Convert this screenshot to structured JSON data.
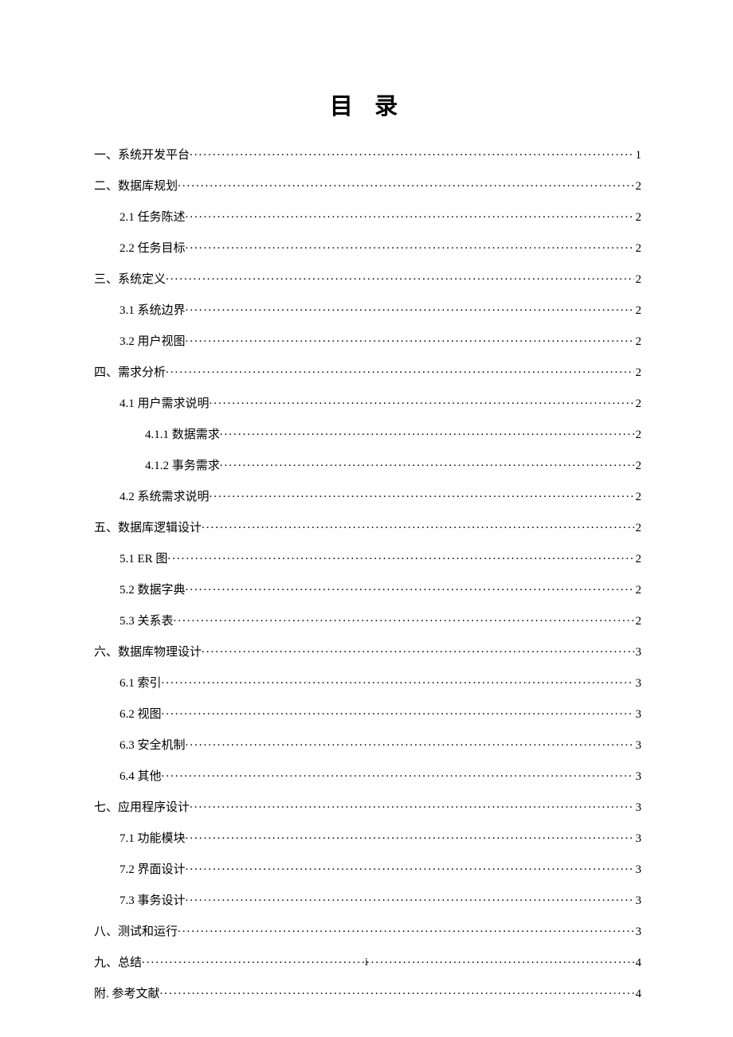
{
  "title": "目 录",
  "page_number": "i",
  "toc": [
    {
      "level": 0,
      "label": "一、系统开发平台",
      "page": "1"
    },
    {
      "level": 0,
      "label": "二、数据库规划",
      "page": "2"
    },
    {
      "level": 1,
      "label": "2.1 任务陈述",
      "page": "2"
    },
    {
      "level": 1,
      "label": "2.2 任务目标",
      "page": "2"
    },
    {
      "level": 0,
      "label": "三、系统定义",
      "page": "2"
    },
    {
      "level": 1,
      "label": "3.1 系统边界",
      "page": "2"
    },
    {
      "level": 1,
      "label": "3.2 用户视图",
      "page": "2"
    },
    {
      "level": 0,
      "label": "四、需求分析",
      "page": "2"
    },
    {
      "level": 1,
      "label": "4.1 用户需求说明",
      "page": "2"
    },
    {
      "level": 2,
      "label": "4.1.1 数据需求",
      "page": "2"
    },
    {
      "level": 2,
      "label": "4.1.2 事务需求",
      "page": "2"
    },
    {
      "level": 1,
      "label": "4.2 系统需求说明",
      "page": "2"
    },
    {
      "level": 0,
      "label": "五、数据库逻辑设计",
      "page": "2"
    },
    {
      "level": 1,
      "label": "5.1 ER 图",
      "page": "2"
    },
    {
      "level": 1,
      "label": "5.2 数据字典",
      "page": "2"
    },
    {
      "level": 1,
      "label": "5.3 关系表",
      "page": "2"
    },
    {
      "level": 0,
      "label": "六、数据库物理设计",
      "page": "3"
    },
    {
      "level": 1,
      "label": "6.1 索引",
      "page": "3"
    },
    {
      "level": 1,
      "label": "6.2 视图",
      "page": "3"
    },
    {
      "level": 1,
      "label": "6.3 安全机制",
      "page": "3"
    },
    {
      "level": 1,
      "label": "6.4 其他",
      "page": "3"
    },
    {
      "level": 0,
      "label": "七、应用程序设计",
      "page": "3"
    },
    {
      "level": 1,
      "label": "7.1 功能模块",
      "page": "3"
    },
    {
      "level": 1,
      "label": "7.2 界面设计",
      "page": "3"
    },
    {
      "level": 1,
      "label": "7.3 事务设计",
      "page": "3"
    },
    {
      "level": 0,
      "label": "八、测试和运行",
      "page": "3"
    },
    {
      "level": 0,
      "label": "九、总结",
      "page": "4"
    },
    {
      "level": 0,
      "label": "附. 参考文献",
      "page": "4"
    }
  ]
}
